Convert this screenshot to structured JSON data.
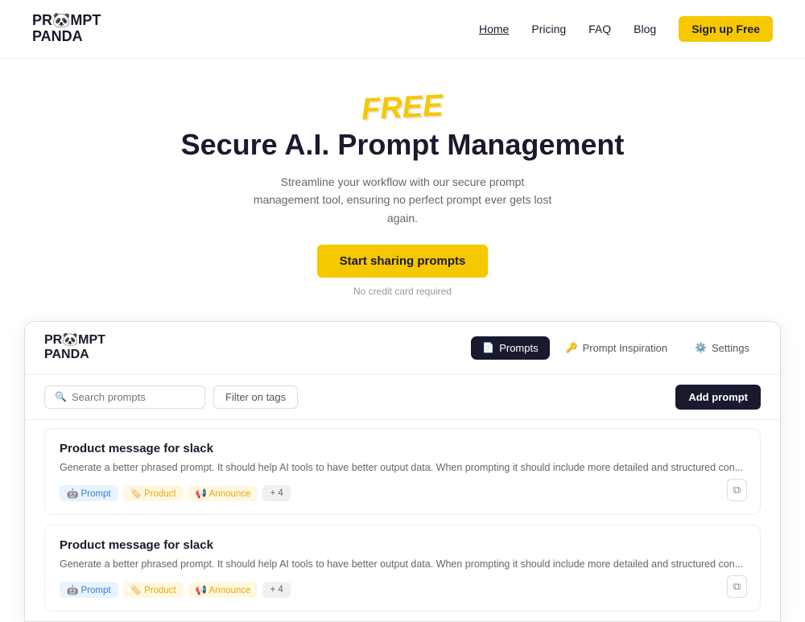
{
  "nav": {
    "logo_line1": "PR🐼MPT",
    "logo_line2": "PANDA",
    "links": [
      {
        "label": "Home",
        "active": true
      },
      {
        "label": "Pricing",
        "active": false
      },
      {
        "label": "FAQ",
        "active": false
      },
      {
        "label": "Blog",
        "active": false
      }
    ],
    "signup_label": "Sign up Free"
  },
  "hero": {
    "free_badge": "FREE",
    "title": "Secure A.I. Prompt Management",
    "subtitle": "Streamline your workflow with our secure prompt management tool, ensuring no perfect prompt ever gets lost again.",
    "cta_label": "Start sharing prompts",
    "no_cc": "No credit card required"
  },
  "mockup": {
    "logo_line1": "PR🐼MPT",
    "logo_line2": "PANDA",
    "tabs": [
      {
        "label": "Prompts",
        "icon": "📄",
        "active": true
      },
      {
        "label": "Prompt Inspiration",
        "icon": "🔑",
        "active": false
      },
      {
        "label": "Settings",
        "icon": "⚙️",
        "active": false
      }
    ],
    "toolbar": {
      "search_placeholder": "Search prompts",
      "filter_label": "Filter on tags",
      "add_label": "Add prompt"
    },
    "cards": [
      {
        "title": "Product message for slack",
        "desc": "Generate a better phrased prompt. It should help AI tools to have better output data. When prompting  it should include more detailed and structured con...",
        "tags": [
          {
            "emoji": "🤖",
            "label": "Prompt",
            "style": "tag-prompt"
          },
          {
            "emoji": "🏷️",
            "label": "Product",
            "style": "tag-product"
          },
          {
            "emoji": "📢",
            "label": "Announce",
            "style": "tag-announce"
          },
          {
            "label": "+ 4",
            "style": "tag-more"
          }
        ]
      },
      {
        "title": "Product message for slack",
        "desc": "Generate a better phrased prompt. It should help AI tools to have better output data. When prompting  it should include more detailed and structured con...",
        "tags": [
          {
            "emoji": "🤖",
            "label": "Prompt",
            "style": "tag-prompt"
          },
          {
            "emoji": "🏷️",
            "label": "Product",
            "style": "tag-product"
          },
          {
            "emoji": "📢",
            "label": "Announce",
            "style": "tag-announce"
          },
          {
            "label": "+ 4",
            "style": "tag-more"
          }
        ]
      }
    ]
  }
}
